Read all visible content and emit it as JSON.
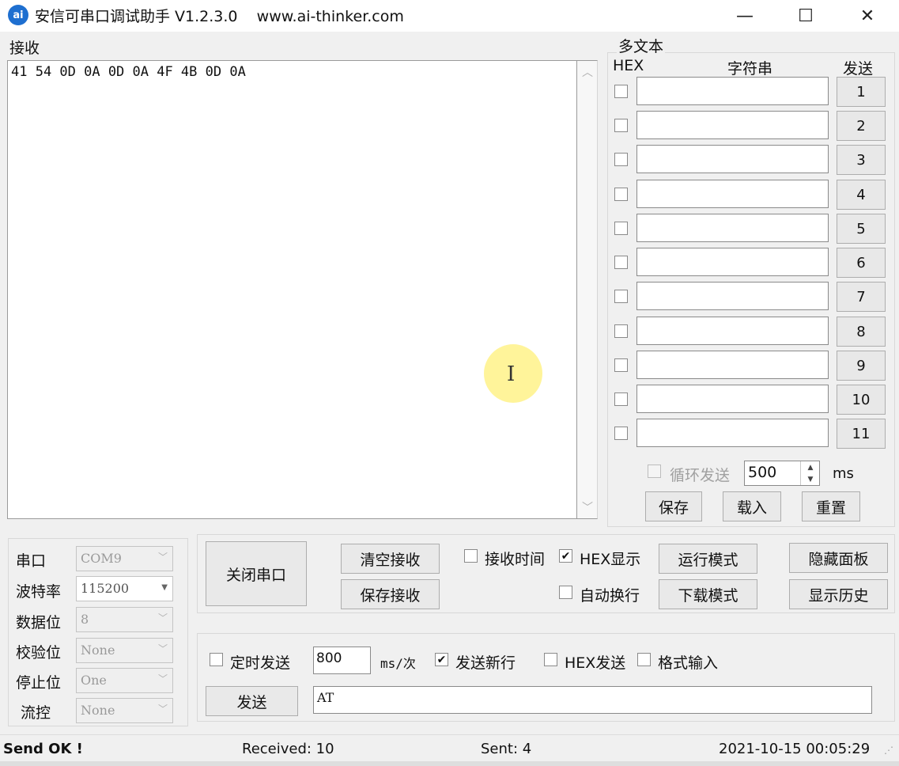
{
  "window": {
    "icon_text": "ai",
    "title": "安信可串口调试助手 V1.2.3.0    www.ai-thinker.com",
    "minimize": "—",
    "maximize": "☐",
    "close": "✕"
  },
  "receive": {
    "label": "接收",
    "content": "41 54 0D 0A 0D 0A 4F 4B 0D 0A"
  },
  "multi_text": {
    "title": "多文本",
    "header_hex": "HEX",
    "header_string": "字符串",
    "header_send": "发送",
    "rows": [
      {
        "button": "1",
        "value": ""
      },
      {
        "button": "2",
        "value": ""
      },
      {
        "button": "3",
        "value": ""
      },
      {
        "button": "4",
        "value": ""
      },
      {
        "button": "5",
        "value": ""
      },
      {
        "button": "6",
        "value": ""
      },
      {
        "button": "7",
        "value": ""
      },
      {
        "button": "8",
        "value": ""
      },
      {
        "button": "9",
        "value": ""
      },
      {
        "button": "10",
        "value": ""
      },
      {
        "button": "11",
        "value": ""
      }
    ],
    "loop_label": "循环发送",
    "loop_interval": "500",
    "loop_unit": "ms",
    "save": "保存",
    "load": "载入",
    "reset": "重置"
  },
  "port_settings": {
    "port_label": "串口",
    "port_value": "COM9",
    "baud_label": "波特率",
    "baud_value": "115200",
    "databits_label": "数据位",
    "databits_value": "8",
    "parity_label": "校验位",
    "parity_value": "None",
    "stopbits_label": "停止位",
    "stopbits_value": "One",
    "flow_label": "流控",
    "flow_value": "None"
  },
  "controls": {
    "close_port": "关闭串口",
    "clear_receive": "清空接收",
    "save_receive": "保存接收",
    "receive_time": "接收时间",
    "hex_display": "HEX显示",
    "hex_display_checked": true,
    "auto_wrap": "自动换行",
    "run_mode": "运行模式",
    "download_mode": "下载模式",
    "hide_panel": "隐藏面板",
    "show_history": "显示历史"
  },
  "send": {
    "timed_send": "定时发送",
    "interval": "800",
    "interval_unit": "ms/次",
    "send_newline": "发送新行",
    "send_newline_checked": true,
    "hex_send": "HEX发送",
    "format_input": "格式输入",
    "send_button": "发送",
    "send_text": "AT"
  },
  "status": {
    "message": "Send OK !",
    "received": "Received: 10",
    "sent": "Sent: 4",
    "datetime": "2021-10-15 00:05:29"
  },
  "colors": {
    "accent": "#1e6fd0",
    "window_bg": "#f0f0f0",
    "cursor_highlight": "#fff078"
  }
}
